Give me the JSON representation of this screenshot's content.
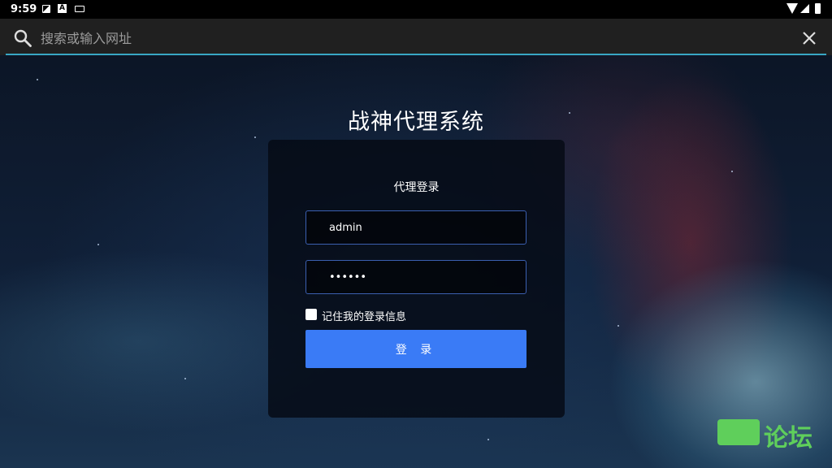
{
  "status_bar": {
    "time": "9:59"
  },
  "search": {
    "placeholder": "搜索或输入网址"
  },
  "page": {
    "title": "战神代理系统"
  },
  "login": {
    "heading": "代理登录",
    "username_value": "admin",
    "password_value": "••••••",
    "remember_label": "记住我的登录信息",
    "submit_label": "登 录"
  },
  "watermark": {
    "text": "论坛"
  },
  "colors": {
    "accent": "#3a7bf6",
    "search_underline": "#39a7c4",
    "watermark_green": "#5fcf5b"
  }
}
